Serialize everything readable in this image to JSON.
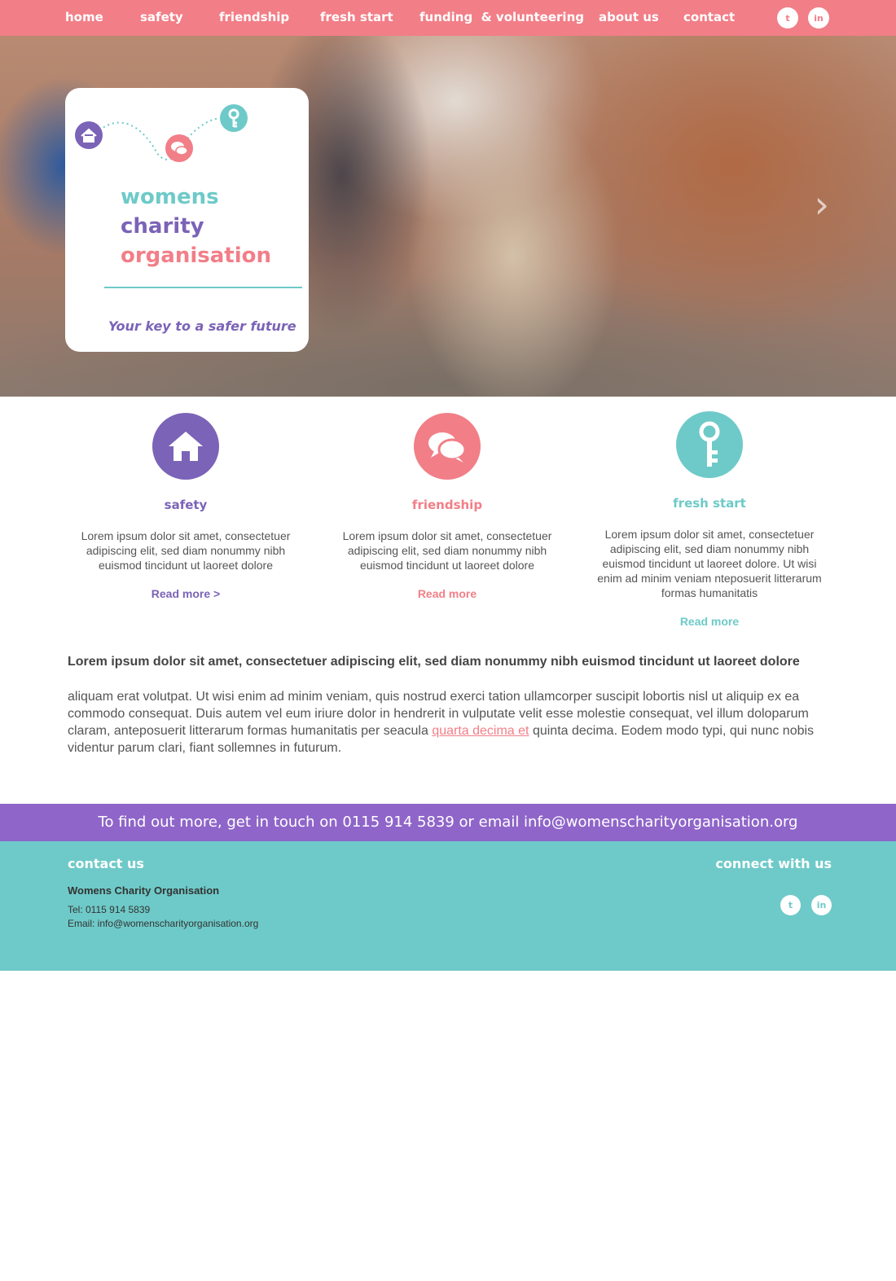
{
  "nav": {
    "items": [
      "home",
      "safety",
      "friendship",
      "fresh start",
      "funding  & volunteering",
      "about us",
      "contact"
    ],
    "social": [
      {
        "icon": "twitter-icon",
        "glyph": "t"
      },
      {
        "icon": "linkedin-icon",
        "glyph": "in"
      }
    ]
  },
  "hero": {
    "logo_line1": "womens",
    "logo_line2": "charity",
    "logo_line3": "organisation",
    "tagline": "Your key to a safer future",
    "next_arrow": "›"
  },
  "features": [
    {
      "title": "safety",
      "icon": "house-icon",
      "color": "#7b63b7",
      "text": "Lorem ipsum dolor sit amet, consectetuer adipiscing elit, sed diam nonummy nibh euismod tincidunt ut laoreet dolore",
      "link": "Read more >"
    },
    {
      "title": "friendship",
      "icon": "speech-bubbles-icon",
      "color": "#f27e87",
      "text": "Lorem ipsum dolor sit amet, consectetuer adipiscing elit, sed diam nonummy nibh euismod tincidunt ut laoreet dolore",
      "link": "Read more"
    },
    {
      "title": "fresh start",
      "icon": "key-icon",
      "color": "#6ecac8",
      "text": "Lorem ipsum dolor sit amet, consectetuer adipiscing elit, sed diam nonummy nibh euismod tincidunt ut laoreet dolore. Ut wisi enim ad minim veniam nteposuerit litterarum formas humanitatis",
      "link": "Read more"
    }
  ],
  "content": {
    "lead": "Lorem ipsum dolor sit amet, consectetuer adipiscing elit, sed diam nonummy nibh euismod tincidunt ut laoreet dolore",
    "body_before": "aliquam erat volutpat. Ut wisi enim ad minim veniam, quis nostrud exerci tation ullamcorper suscipit lobortis nisl ut aliquip ex ea commodo consequat. Duis autem vel eum iriure dolor in hendrerit in vulputate velit esse molestie consequat, vel illum doloparum claram, anteposuerit litterarum formas humanitatis per seacula ",
    "body_link": "quarta decima et",
    "body_after": " quinta decima. Eodem modo typi, qui nunc nobis videntur parum clari, fiant sollemnes in futurum."
  },
  "cta": {
    "text": "To find out more, get in touch on 0115 914 5839 or email info@womenscharityorganisation.org"
  },
  "footer": {
    "contact_heading": "contact us",
    "org_name": "Womens Charity Organisation",
    "tel": "Tel: 0115 914 5839",
    "email": "Email: info@womenscharityorganisation.org",
    "connect_heading": "connect with us"
  },
  "colors": {
    "pink": "#f27e87",
    "purple": "#7b63b7",
    "teal": "#6ecac8",
    "strip_purple": "#8f65c9"
  }
}
